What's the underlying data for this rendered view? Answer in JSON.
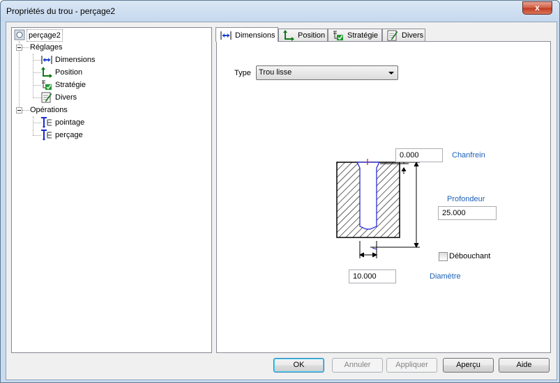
{
  "window": {
    "title": "Propriétés du trou - perçage2",
    "close_glyph": "x"
  },
  "tree": {
    "root": "perçage2",
    "settings_group": "Réglages",
    "settings_items": [
      "Dimensions",
      "Position",
      "Stratégie",
      "Divers"
    ],
    "operations_group": "Opérations",
    "operation_items": [
      "pointage",
      "perçage"
    ]
  },
  "tabs": [
    "Dimensions",
    "Position",
    "Stratégie",
    "Divers"
  ],
  "dimensions": {
    "type_label": "Type",
    "type_value": "Trou lisse",
    "chamfer_value": "0.000",
    "chamfer_label": "Chanfrein",
    "depth_label": "Profondeur",
    "depth_value": "25.000",
    "through_label": "Débouchant",
    "through_checked": false,
    "diameter_value": "10.000",
    "diameter_label": "Diamètre"
  },
  "buttons": {
    "ok": "OK",
    "cancel": "Annuler",
    "apply": "Appliquer",
    "preview": "Aperçu",
    "help": "Aide"
  },
  "colors": {
    "link_blue": "#1b5fb7",
    "hole_outline": "#1a1ad6",
    "marker_red": "#e01010"
  }
}
